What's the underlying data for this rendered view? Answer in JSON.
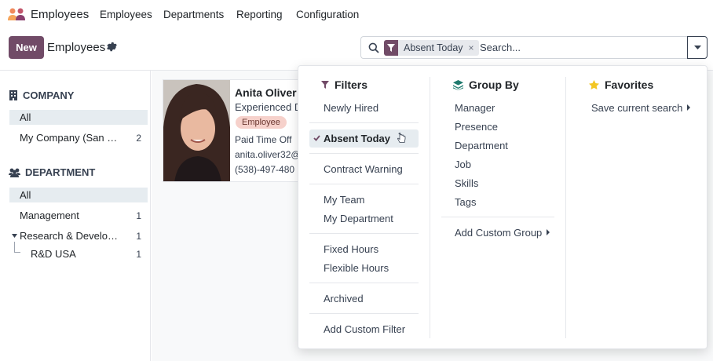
{
  "app": {
    "name": "Employees",
    "nav": [
      "Employees",
      "Departments",
      "Reporting",
      "Configuration"
    ]
  },
  "control": {
    "new_label": "New",
    "breadcrumb": "Employees"
  },
  "search": {
    "facet_label": "Absent Today",
    "facet_remove": "×",
    "placeholder": "Search..."
  },
  "sidebar": {
    "company": {
      "title": "COMPANY",
      "items": [
        {
          "label": "All",
          "count": ""
        },
        {
          "label": "My Company (San Fra...",
          "count": "2"
        }
      ]
    },
    "department": {
      "title": "DEPARTMENT",
      "items": [
        {
          "label": "All",
          "count": ""
        },
        {
          "label": "Management",
          "count": "1"
        },
        {
          "label": "Research & Developm...",
          "count": "1"
        },
        {
          "label": "R&D USA",
          "count": "1"
        }
      ]
    }
  },
  "card": {
    "name": "Anita Oliver",
    "job": "Experienced D",
    "tag": "Employee",
    "status": "Paid Time Off",
    "email": "anita.oliver32@",
    "phone": "(538)-497-480"
  },
  "dropdown": {
    "filters": {
      "title": "Filters",
      "items": [
        "Newly Hired",
        "Absent Today",
        "Contract Warning",
        "My Team",
        "My Department",
        "Fixed Hours",
        "Flexible Hours",
        "Archived",
        "Add Custom Filter"
      ]
    },
    "groupby": {
      "title": "Group By",
      "items": [
        "Manager",
        "Presence",
        "Department",
        "Job",
        "Skills",
        "Tags",
        "Add Custom Group"
      ]
    },
    "favorites": {
      "title": "Favorites",
      "items": [
        "Save current search"
      ]
    }
  },
  "colors": {
    "brand": "#714b67",
    "selected_bg": "#e6ecf0",
    "tag_bg": "#f6d1cb",
    "star": "#f3c623",
    "groupby_icon": "#1f7a6e"
  }
}
